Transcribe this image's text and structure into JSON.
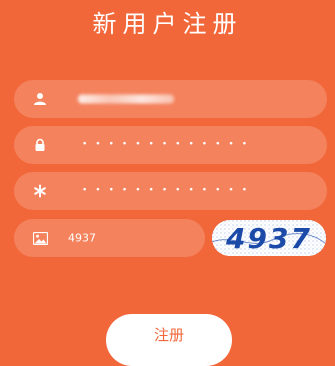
{
  "header": {
    "title": "新用户注册"
  },
  "form": {
    "username": {
      "icon": "user-icon",
      "value_obscured": true
    },
    "password": {
      "icon": "lock-icon",
      "masked_value": "•••••••••••••"
    },
    "confirm_password": {
      "icon": "asterisk-icon",
      "masked_value": "•••••••••••••"
    },
    "captcha": {
      "icon": "image-icon",
      "value": "4937",
      "image_text": "4937"
    }
  },
  "actions": {
    "register_label": "注册"
  },
  "colors": {
    "background": "#f2673a",
    "field_background": "rgba(255,255,255,0.18)",
    "captcha_text": "#1b4aa8"
  }
}
